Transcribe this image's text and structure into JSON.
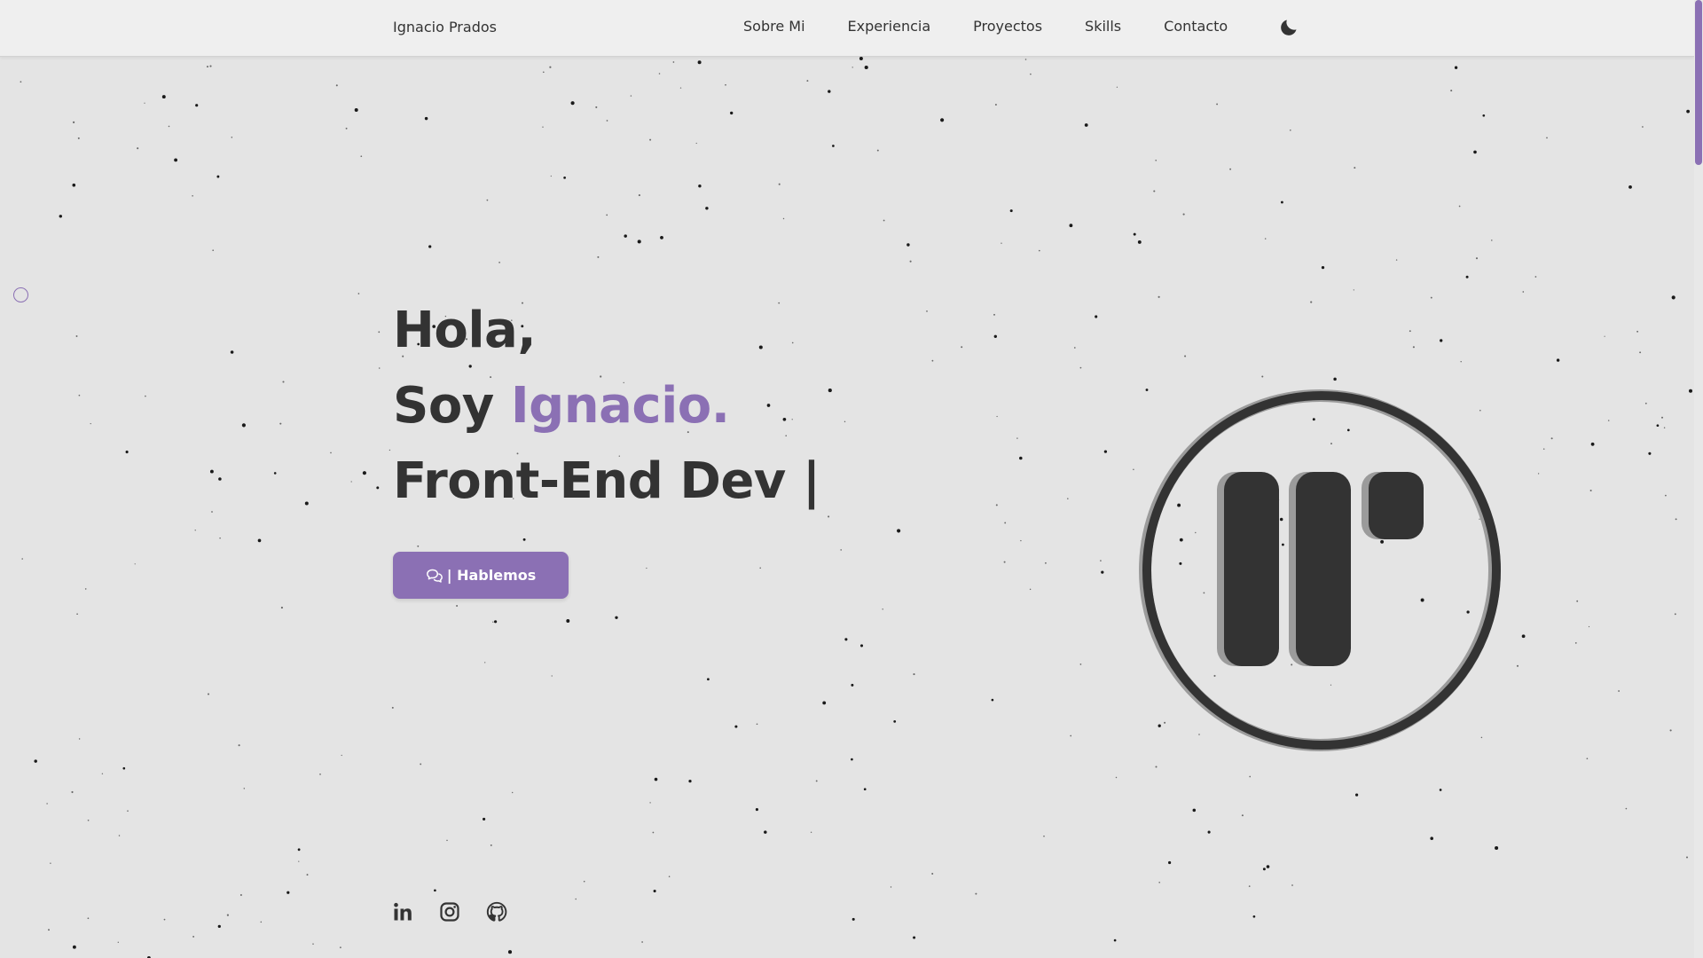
{
  "navbar": {
    "brand": "Ignacio Prados",
    "links": [
      "Sobre Mi",
      "Experiencia",
      "Proyectos",
      "Skills",
      "Contacto"
    ],
    "theme_toggle_icon": "moon-icon"
  },
  "hero": {
    "line1": "Hola,",
    "line2_prefix": "Soy ",
    "line2_name": "Ignacio.",
    "line3": "Front-End Dev |",
    "cta_icon": "chat-icon",
    "cta_label": "| Hablemos"
  },
  "logo": {
    "icon": "ip-monogram-logo"
  },
  "socials": [
    {
      "icon": "linkedin-icon"
    },
    {
      "icon": "instagram-icon"
    },
    {
      "icon": "github-icon"
    }
  ],
  "colors": {
    "accent": "#8b70b4",
    "text": "#333333",
    "background": "#e4e4e4",
    "navbar": "#efefef"
  }
}
